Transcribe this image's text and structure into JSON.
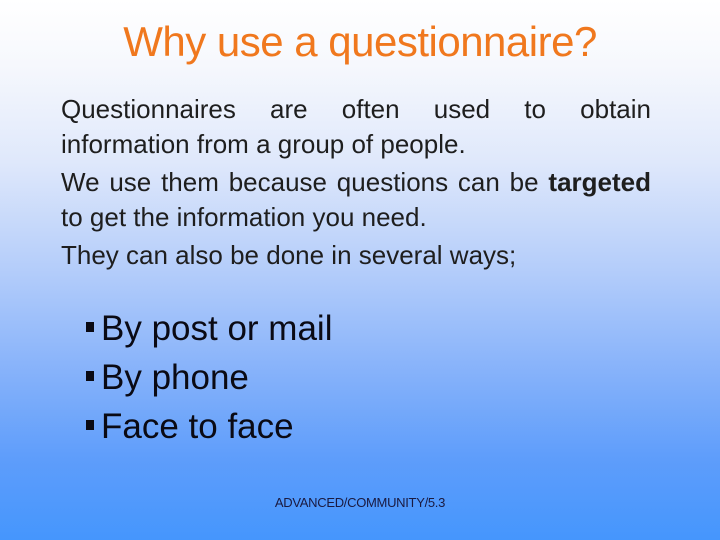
{
  "slide": {
    "title": "Why use a questionnaire?",
    "paragraphs": [
      {
        "text": "Questionnaires are often used to obtain information from a group of people."
      },
      {
        "bold_lead": "targeted",
        "pre": "We use them because questions can be",
        "post": "to get the information you need."
      },
      {
        "text": "They can also be done in several ways;"
      }
    ],
    "bullets": [
      "By post or mail",
      "By phone",
      "Face to face"
    ],
    "footer": "ADVANCED/COMMUNITY/5.3",
    "colors": {
      "title": "#f0781e",
      "body_text": "#1e1e1e",
      "gradient_top": "#ffffff",
      "gradient_bottom": "#4596fd"
    }
  }
}
